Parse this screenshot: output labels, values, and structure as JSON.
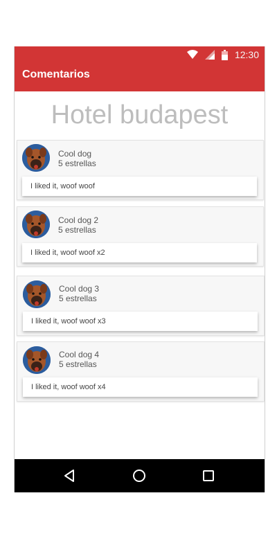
{
  "status_bar": {
    "time": "12:30",
    "icons": [
      "wifi-icon",
      "signal-icon",
      "battery-icon"
    ],
    "color": "#d23535"
  },
  "app_bar": {
    "title": "Comentarios",
    "color": "#d23535"
  },
  "hotel": {
    "name": "Hotel budapest"
  },
  "reviews": [
    {
      "name": "Cool dog",
      "rating": "5 estrellas",
      "comment": "I liked it, woof woof"
    },
    {
      "name": "Cool dog 2",
      "rating": "5 estrellas",
      "comment": "I liked it, woof woof x2"
    },
    {
      "name": "Cool dog 3",
      "rating": "5 estrellas",
      "comment": "I liked it, woof woof x3"
    },
    {
      "name": "Cool dog 4",
      "rating": "5 estrellas",
      "comment": "I liked it, woof woof x4"
    }
  ],
  "nav_bar": {
    "buttons": [
      "back-icon",
      "home-icon",
      "recents-icon"
    ]
  }
}
